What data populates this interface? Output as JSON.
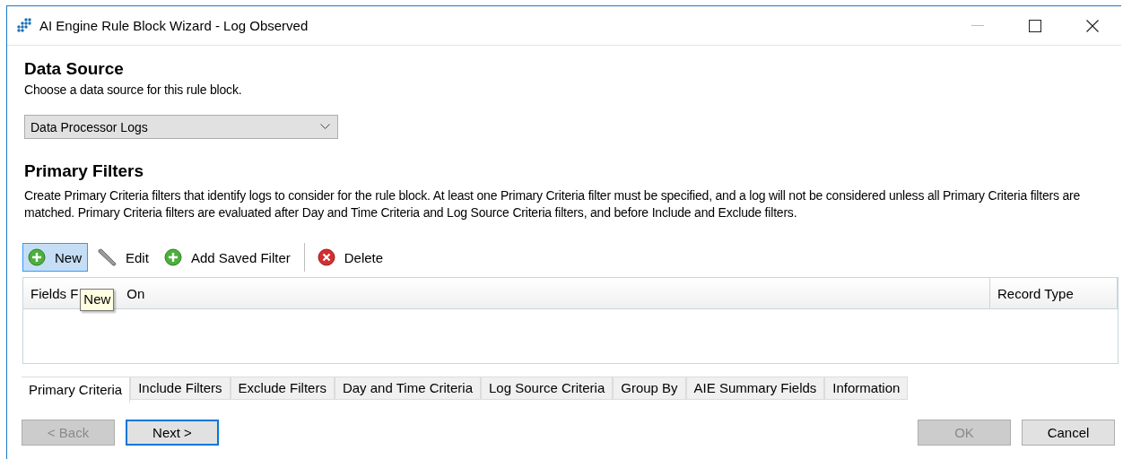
{
  "window": {
    "title": "AI Engine Rule Block Wizard - Log Observed"
  },
  "data_source": {
    "heading": "Data Source",
    "description": "Choose a data source for this rule block.",
    "dropdown": {
      "value": "Data Processor Logs"
    }
  },
  "primary_filters": {
    "heading": "Primary Filters",
    "description": "Create Primary Criteria filters that identify logs to consider for the rule block. At least one Primary Criteria filter must be specified, and a log will not be considered unless all Primary Criteria filters are matched. Primary Criteria filters are evaluated after Day and Time Criteria and Log Source Criteria filters, and before Include and Exclude filters."
  },
  "toolbar": [
    {
      "kind": "add",
      "label": "New",
      "hovered": true
    },
    {
      "kind": "edit",
      "label": "Edit",
      "hovered": false
    },
    {
      "kind": "add",
      "label": "Add Saved Filter",
      "hovered": false
    },
    {
      "kind": "separator"
    },
    {
      "kind": "delete",
      "label": "Delete",
      "hovered": false
    }
  ],
  "tooltip": {
    "text": "New"
  },
  "table": {
    "columns": [
      {
        "label": "Fields F",
        "label_after_tooltip": "On"
      },
      {
        "label": "Record Type"
      }
    ]
  },
  "tabs": [
    {
      "label": "Primary Criteria",
      "selected": true
    },
    {
      "label": "Include Filters",
      "selected": false
    },
    {
      "label": "Exclude Filters",
      "selected": false
    },
    {
      "label": "Day and Time Criteria",
      "selected": false
    },
    {
      "label": "Log Source Criteria",
      "selected": false
    },
    {
      "label": "Group By",
      "selected": false
    },
    {
      "label": "AIE Summary Fields",
      "selected": false
    },
    {
      "label": "Information",
      "selected": false
    }
  ],
  "buttons": [
    {
      "label": "< Back",
      "disabled": true,
      "default": false
    },
    {
      "label": "Next >",
      "disabled": false,
      "default": true
    },
    {
      "label": "OK",
      "disabled": true,
      "default": false
    },
    {
      "label": "Cancel",
      "disabled": false,
      "default": false
    }
  ]
}
